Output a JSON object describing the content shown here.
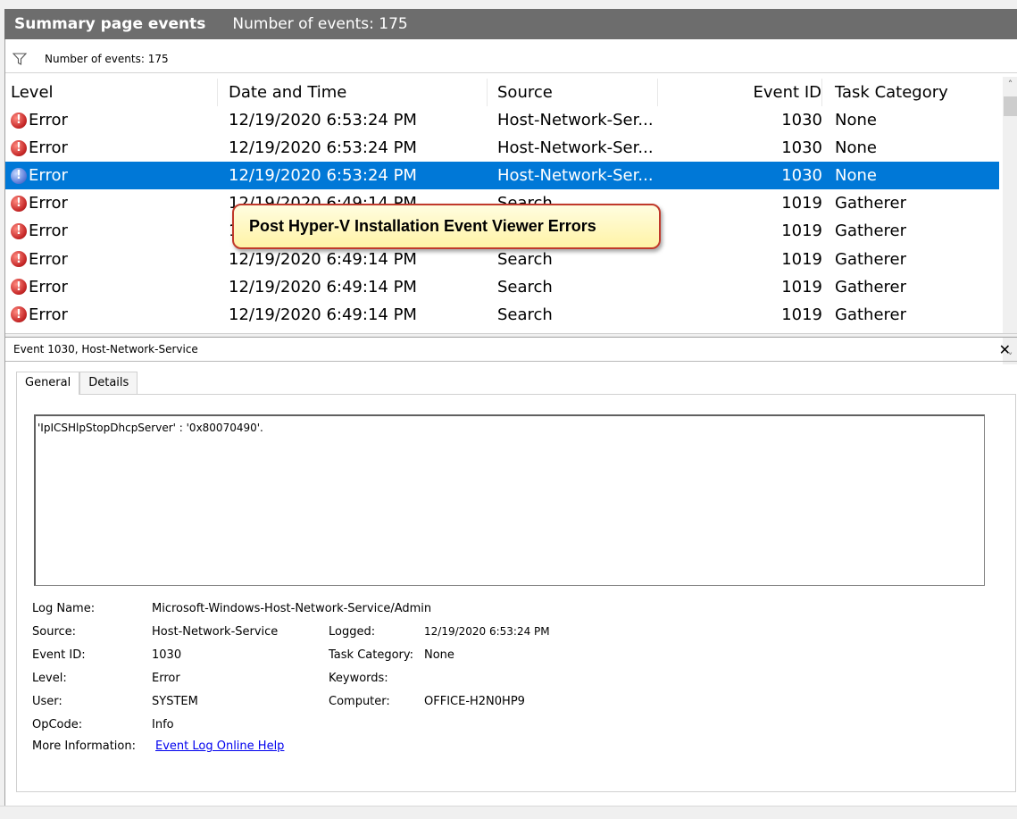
{
  "window": {
    "title": "Summary page events",
    "event_count_label": "Number of events: 175"
  },
  "filter": {
    "label": "Number of events: 175"
  },
  "grid": {
    "headers": {
      "level": "Level",
      "date": "Date and Time",
      "source": "Source",
      "event_id": "Event ID",
      "task": "Task Category"
    },
    "rows": [
      {
        "level": "Error",
        "date": "12/19/2020 6:53:24 PM",
        "source": "Host-Network-Ser...",
        "event_id": "1030",
        "task": "None"
      },
      {
        "level": "Error",
        "date": "12/19/2020 6:53:24 PM",
        "source": "Host-Network-Ser...",
        "event_id": "1030",
        "task": "None"
      },
      {
        "level": "Error",
        "date": "12/19/2020 6:53:24 PM",
        "source": "Host-Network-Ser...",
        "event_id": "1030",
        "task": "None"
      },
      {
        "level": "Error",
        "date": "12/19/2020 6:49:14 PM",
        "source": "Search",
        "event_id": "1019",
        "task": "Gatherer"
      },
      {
        "level": "Error",
        "date": "12/19/2020 6:49:14 PM",
        "source": "Search",
        "event_id": "1019",
        "task": "Gatherer"
      },
      {
        "level": "Error",
        "date": "12/19/2020 6:49:14 PM",
        "source": "Search",
        "event_id": "1019",
        "task": "Gatherer"
      },
      {
        "level": "Error",
        "date": "12/19/2020 6:49:14 PM",
        "source": "Search",
        "event_id": "1019",
        "task": "Gatherer"
      },
      {
        "level": "Error",
        "date": "12/19/2020 6:49:14 PM",
        "source": "Search",
        "event_id": "1019",
        "task": "Gatherer"
      }
    ]
  },
  "callout": {
    "text": "Post Hyper-V Installation Event Viewer Errors"
  },
  "detail": {
    "title": "Event 1030, Host-Network-Service",
    "tabs": [
      "General",
      "Details"
    ],
    "message": "'IpICSHlpStopDhcpServer' : '0x80070490'.",
    "fields": {
      "log_name_label": "Log Name:",
      "log_name": "Microsoft-Windows-Host-Network-Service/Admin",
      "source_label": "Source:",
      "source": "Host-Network-Service",
      "logged_label": "Logged:",
      "logged": "12/19/2020 6:53:24 PM",
      "event_id_label": "Event ID:",
      "event_id": "1030",
      "task_category_label": "Task Category:",
      "task_category": "None",
      "level_label": "Level:",
      "level": "Error",
      "keywords_label": "Keywords:",
      "keywords": "",
      "user_label": "User:",
      "user": "SYSTEM",
      "computer_label": "Computer:",
      "computer": "OFFICE-H2N0HP9",
      "opcode_label": "OpCode:",
      "opcode": "Info",
      "more_info_label": "More Information:",
      "more_info_link": "Event Log Online Help"
    }
  },
  "colors": {
    "selection": "#0078d7",
    "titlebar": "#6d6d6d",
    "error": "#c62828",
    "callout_border": "#c0392b"
  },
  "selected_row_index": 2
}
